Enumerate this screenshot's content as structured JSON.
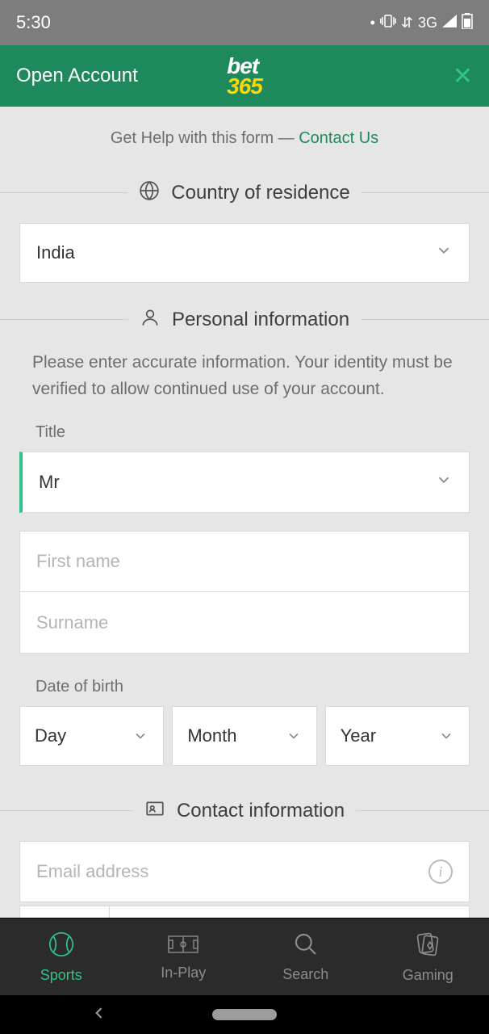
{
  "status": {
    "time": "5:30",
    "net": "3G"
  },
  "header": {
    "title": "Open Account",
    "logo_top": "bet",
    "logo_bottom": "365"
  },
  "help": {
    "prefix": "Get Help with this form — ",
    "link": "Contact Us"
  },
  "sections": {
    "country": {
      "heading": "Country of residence"
    },
    "personal": {
      "heading": "Personal information",
      "hint": "Please enter accurate information. Your identity must be verified to allow continued use of your account."
    },
    "contact": {
      "heading": "Contact information"
    }
  },
  "fields": {
    "country": {
      "value": "India"
    },
    "title_label": "Title",
    "title": {
      "value": "Mr"
    },
    "first_name": {
      "placeholder": "First name"
    },
    "surname": {
      "placeholder": "Surname"
    },
    "dob_label": "Date of birth",
    "dob": {
      "day": "Day",
      "month": "Month",
      "year": "Year"
    },
    "email": {
      "placeholder": "Email address"
    }
  },
  "nav": {
    "sports": "Sports",
    "inplay": "In-Play",
    "search": "Search",
    "gaming": "Gaming"
  }
}
